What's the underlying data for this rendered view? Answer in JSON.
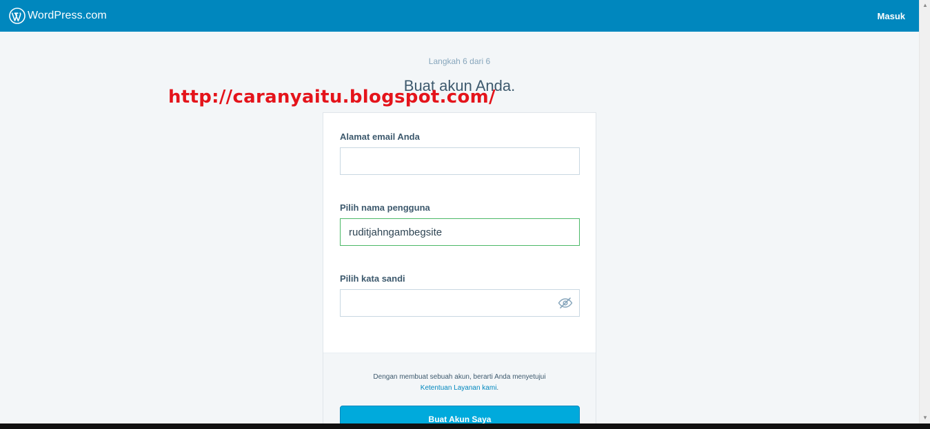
{
  "masterbar": {
    "brand_name": "WordPress.com",
    "login_label": "Masuk",
    "color": "#0087be"
  },
  "signup": {
    "step_text": "Langkah 6 dari 6",
    "heading": "Buat akun Anda."
  },
  "watermark": "http://caranyaitu.blogspot.com/",
  "form": {
    "email_label": "Alamat email Anda",
    "email_value": "",
    "username_label": "Pilih nama pengguna",
    "username_value": "ruditjahngambegsite",
    "password_label": "Pilih kata sandi",
    "password_value": "",
    "password_toggle_icon": "eye-off-icon"
  },
  "footer": {
    "tos_text": "Dengan membuat sebuah akun, berarti Anda menyetujui",
    "tos_link": "Ketentuan Layanan kami",
    "tos_period": ".",
    "submit_label": "Buat Akun Saya"
  },
  "colors": {
    "primary_button": "#00aadc",
    "valid_border": "#4ab866",
    "watermark": "#e4141b"
  }
}
